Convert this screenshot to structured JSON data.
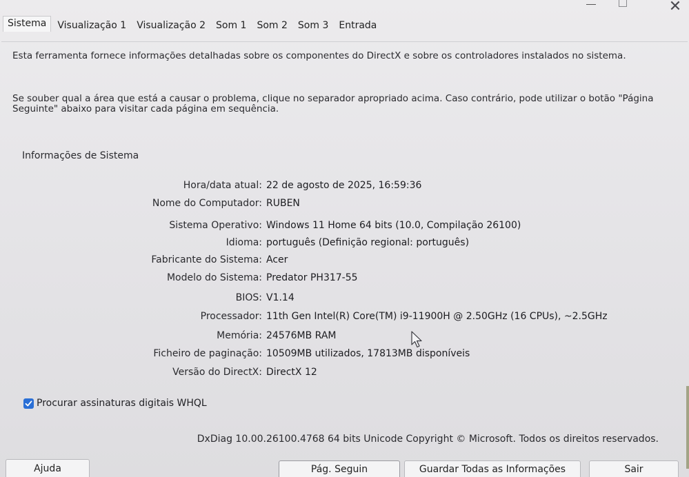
{
  "window": {
    "minimize_glyph": "—",
    "close_glyph": "✕"
  },
  "tabs": [
    {
      "label": "Sistema",
      "active": true
    },
    {
      "label": "Visualização 1",
      "active": false
    },
    {
      "label": "Visualização 2",
      "active": false
    },
    {
      "label": "Som 1",
      "active": false
    },
    {
      "label": "Som 2",
      "active": false
    },
    {
      "label": "Som 3",
      "active": false
    },
    {
      "label": "Entrada",
      "active": false
    }
  ],
  "intro": {
    "line1": "Esta ferramenta fornece informações detalhadas sobre os componentes do DirectX e sobre os controladores instalados no sistema.",
    "line2": "Se souber qual a área que está a causar o problema, clique no separador apropriado acima. Caso contrário, pode utilizar o botão \"Página Seguinte\" abaixo para visitar cada página em sequência."
  },
  "system_info": {
    "group_label": "Informações de Sistema",
    "rows": [
      {
        "label": "Hora/data atual:",
        "value": "22 de agosto de 2025, 16:59:36"
      },
      {
        "label": "Nome do Computador:",
        "value": "RUBEN"
      },
      {
        "label": "Sistema Operativo:",
        "value": "Windows 11 Home 64 bits (10.0, Compilação 26100)"
      },
      {
        "label": "Idioma:",
        "value": "português (Definição regional: português)"
      },
      {
        "label": "Fabricante do Sistema:",
        "value": "Acer"
      },
      {
        "label": "Modelo do Sistema:",
        "value": "Predator PH317-55"
      },
      {
        "label": "BIOS:",
        "value": "V1.14"
      },
      {
        "label": "Processador:",
        "value": "11th Gen Intel(R) Core(TM) i9-11900H @ 2.50GHz (16 CPUs), ~2.5GHz"
      },
      {
        "label": "Memória:",
        "value": "24576MB RAM"
      },
      {
        "label": "Ficheiro de paginação:",
        "value": "10509MB utilizados, 17813MB disponíveis"
      },
      {
        "label": "Versão do DirectX:",
        "value": "DirectX 12"
      }
    ]
  },
  "whql": {
    "label": "Procurar assinaturas digitais WHQL",
    "checked": true
  },
  "copyright": "DxDiag 10.00.26100.4768 64 bits Unicode Copyright © Microsoft. Todos os direitos reservados.",
  "buttons": {
    "help": "Ajuda",
    "next": "Pág. Seguin",
    "save": "Guardar Todas as Informações",
    "exit": "Sair"
  },
  "colors": {
    "accent": "#2a6fd6",
    "background": "#e7e6e8"
  }
}
